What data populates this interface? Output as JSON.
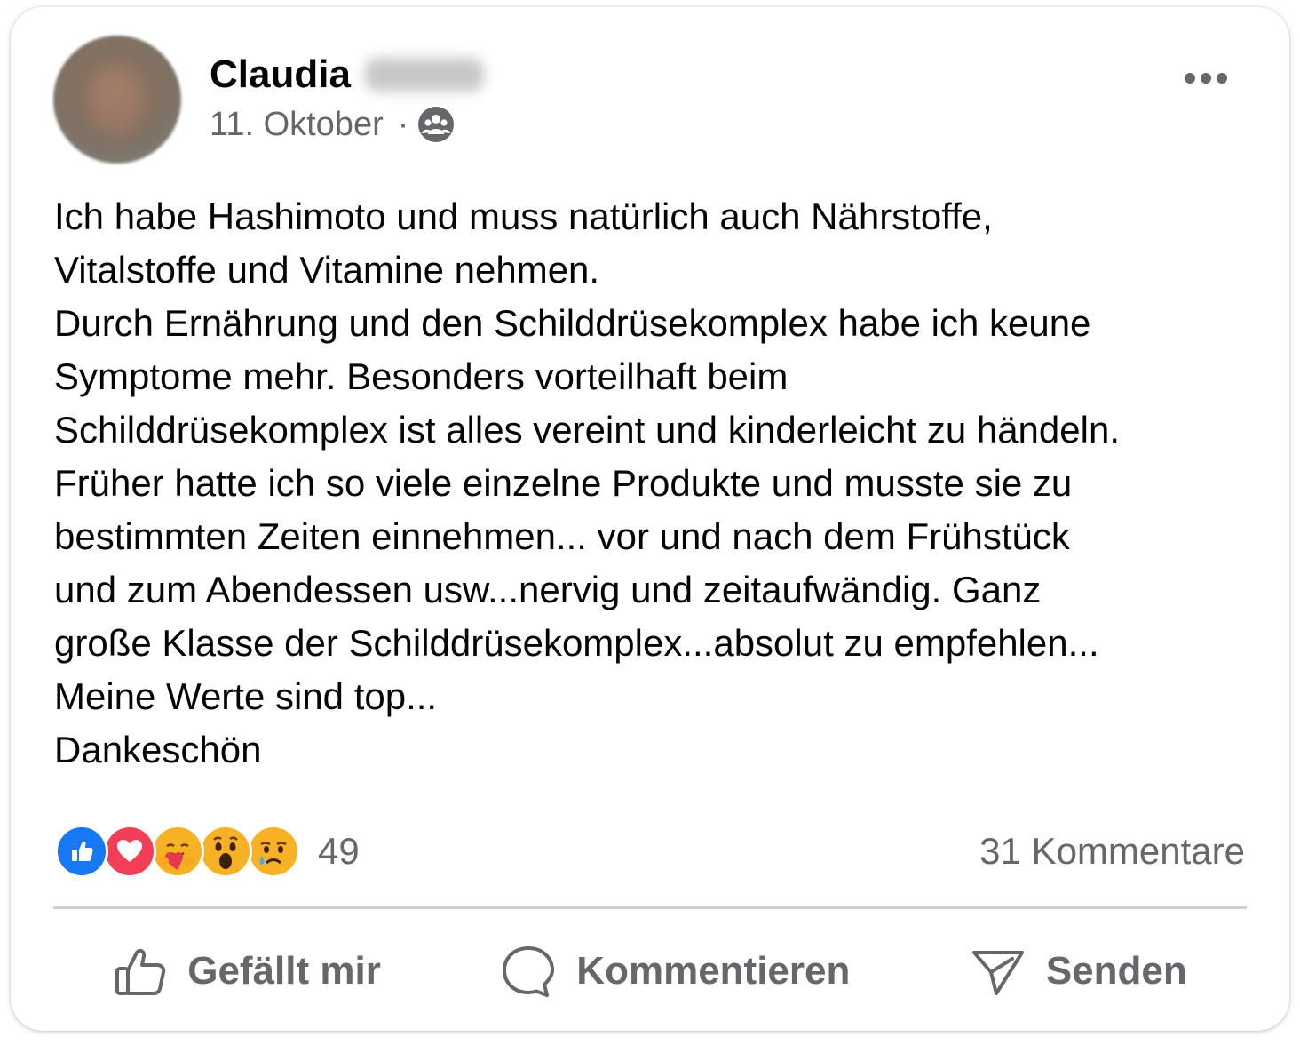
{
  "post": {
    "author_name": "Claudia",
    "date": "11. Oktober",
    "separator": "·",
    "audience_icon": "group-icon",
    "text_lines": [
      "Ich habe Hashimoto und muss natürlich auch Nährstoffe,",
      "Vitalstoffe und Vitamine nehmen.",
      "Durch Ernährung und den Schilddrüsekomplex habe ich keune",
      "Symptome mehr. Besonders vorteilhaft beim",
      "Schilddrüsekomplex ist alles vereint und kinderleicht zu händeln.",
      "Früher hatte ich so viele einzelne Produkte und musste sie zu",
      "bestimmten Zeiten einnehmen... vor und nach dem Frühstück",
      "und zum Abendessen usw...nervig und zeitaufwändig. Ganz",
      "große Klasse der Schilddrüsekomplex...absolut zu empfehlen...",
      "Meine Werte sind top...",
      "Dankeschön"
    ]
  },
  "reactions": {
    "icons": [
      "like-icon",
      "love-icon",
      "care-icon",
      "wow-icon",
      "sad-icon"
    ],
    "count": "49"
  },
  "comments": {
    "count_label": "31 Kommentare"
  },
  "actions": {
    "like_label": "Gefällt mir",
    "comment_label": "Kommentieren",
    "send_label": "Senden"
  },
  "colors": {
    "text": "#050505",
    "secondary": "#65676b",
    "like_blue": "#1877f2",
    "love_red": "#f33e58",
    "emoji_yellow": "#f7b125",
    "divider": "#ced0d4"
  }
}
